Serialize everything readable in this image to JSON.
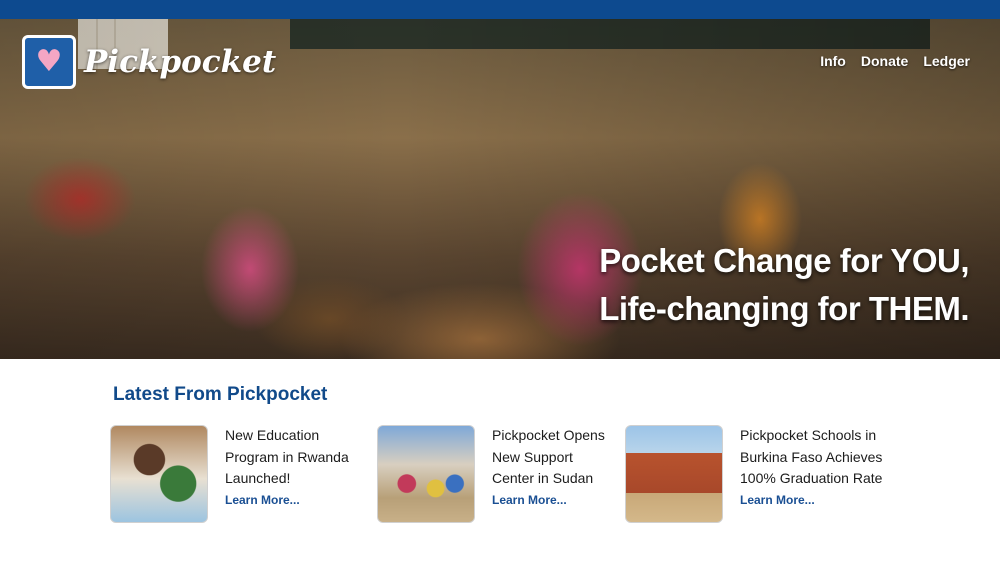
{
  "header": {
    "brand_name": "Pickpocket",
    "logo_icon": "heart-in-pocket-icon",
    "nav": [
      "Info",
      "Donate",
      "Ledger"
    ]
  },
  "hero": {
    "tagline_line1": "Pocket Change for YOU,",
    "tagline_line2": "Life-changing for THEM."
  },
  "latest": {
    "title": "Latest From Pickpocket",
    "items": [
      {
        "title": "New Education\nProgram in Rwanda\nLaunched!",
        "link": "Learn More..."
      },
      {
        "title": "Pickpocket Opens\nNew Support\nCenter in Sudan",
        "link": "Learn More..."
      },
      {
        "title": "Pickpocket Schools in\nBurkina Faso Achieves\n100% Graduation Rate",
        "link": "Learn More..."
      }
    ]
  },
  "colors": {
    "brand_blue": "#0d4a8f",
    "heading_blue": "#114a8a",
    "link_blue": "#1a4f93"
  }
}
